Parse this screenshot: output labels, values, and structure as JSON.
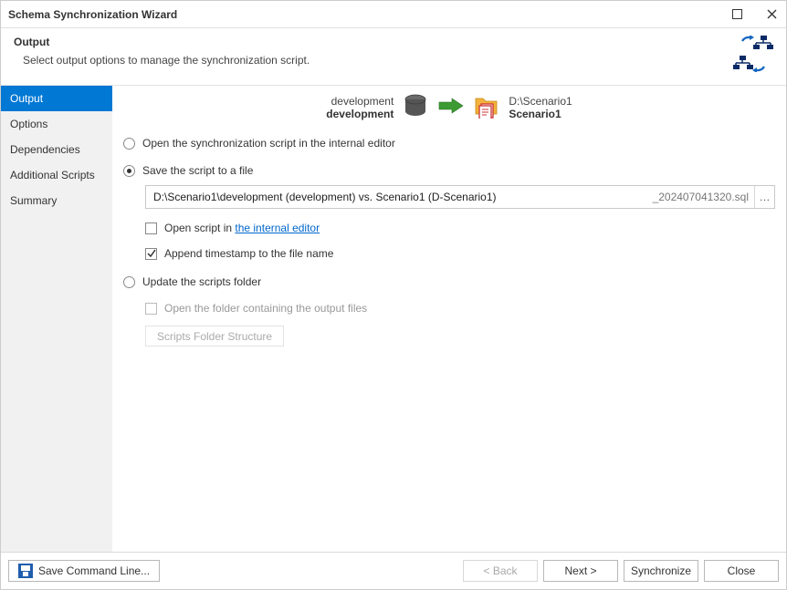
{
  "titlebar": {
    "title": "Schema Synchronization Wizard"
  },
  "header": {
    "title": "Output",
    "desc": "Select output options to manage the synchronization script."
  },
  "sidebar": {
    "items": [
      {
        "label": "Output",
        "active": true
      },
      {
        "label": "Options"
      },
      {
        "label": "Dependencies"
      },
      {
        "label": "Additional Scripts"
      },
      {
        "label": "Summary"
      }
    ]
  },
  "source": {
    "path": "development",
    "name": "development"
  },
  "dest": {
    "path": "D:\\Scenario1",
    "name": "Scenario1"
  },
  "radios": {
    "open_editor": "Open the synchronization script in the internal editor",
    "save_file": "Save the script to a file",
    "update_folder": "Update the scripts folder"
  },
  "file": {
    "path": "D:\\Scenario1\\development (development) vs. Scenario1 (D-Scenario1)",
    "suffix": "_202407041320.sql"
  },
  "checks": {
    "open_in_prefix": "Open script in ",
    "open_in_link": "the internal editor",
    "append_ts": "Append timestamp to the file name",
    "open_folder": "Open the folder containing the output files"
  },
  "buttons": {
    "scripts_folder": "Scripts Folder Structure",
    "save_cmd": "Save Command Line...",
    "back": "< Back",
    "next": "Next >",
    "sync": "Synchronize",
    "close": "Close"
  }
}
